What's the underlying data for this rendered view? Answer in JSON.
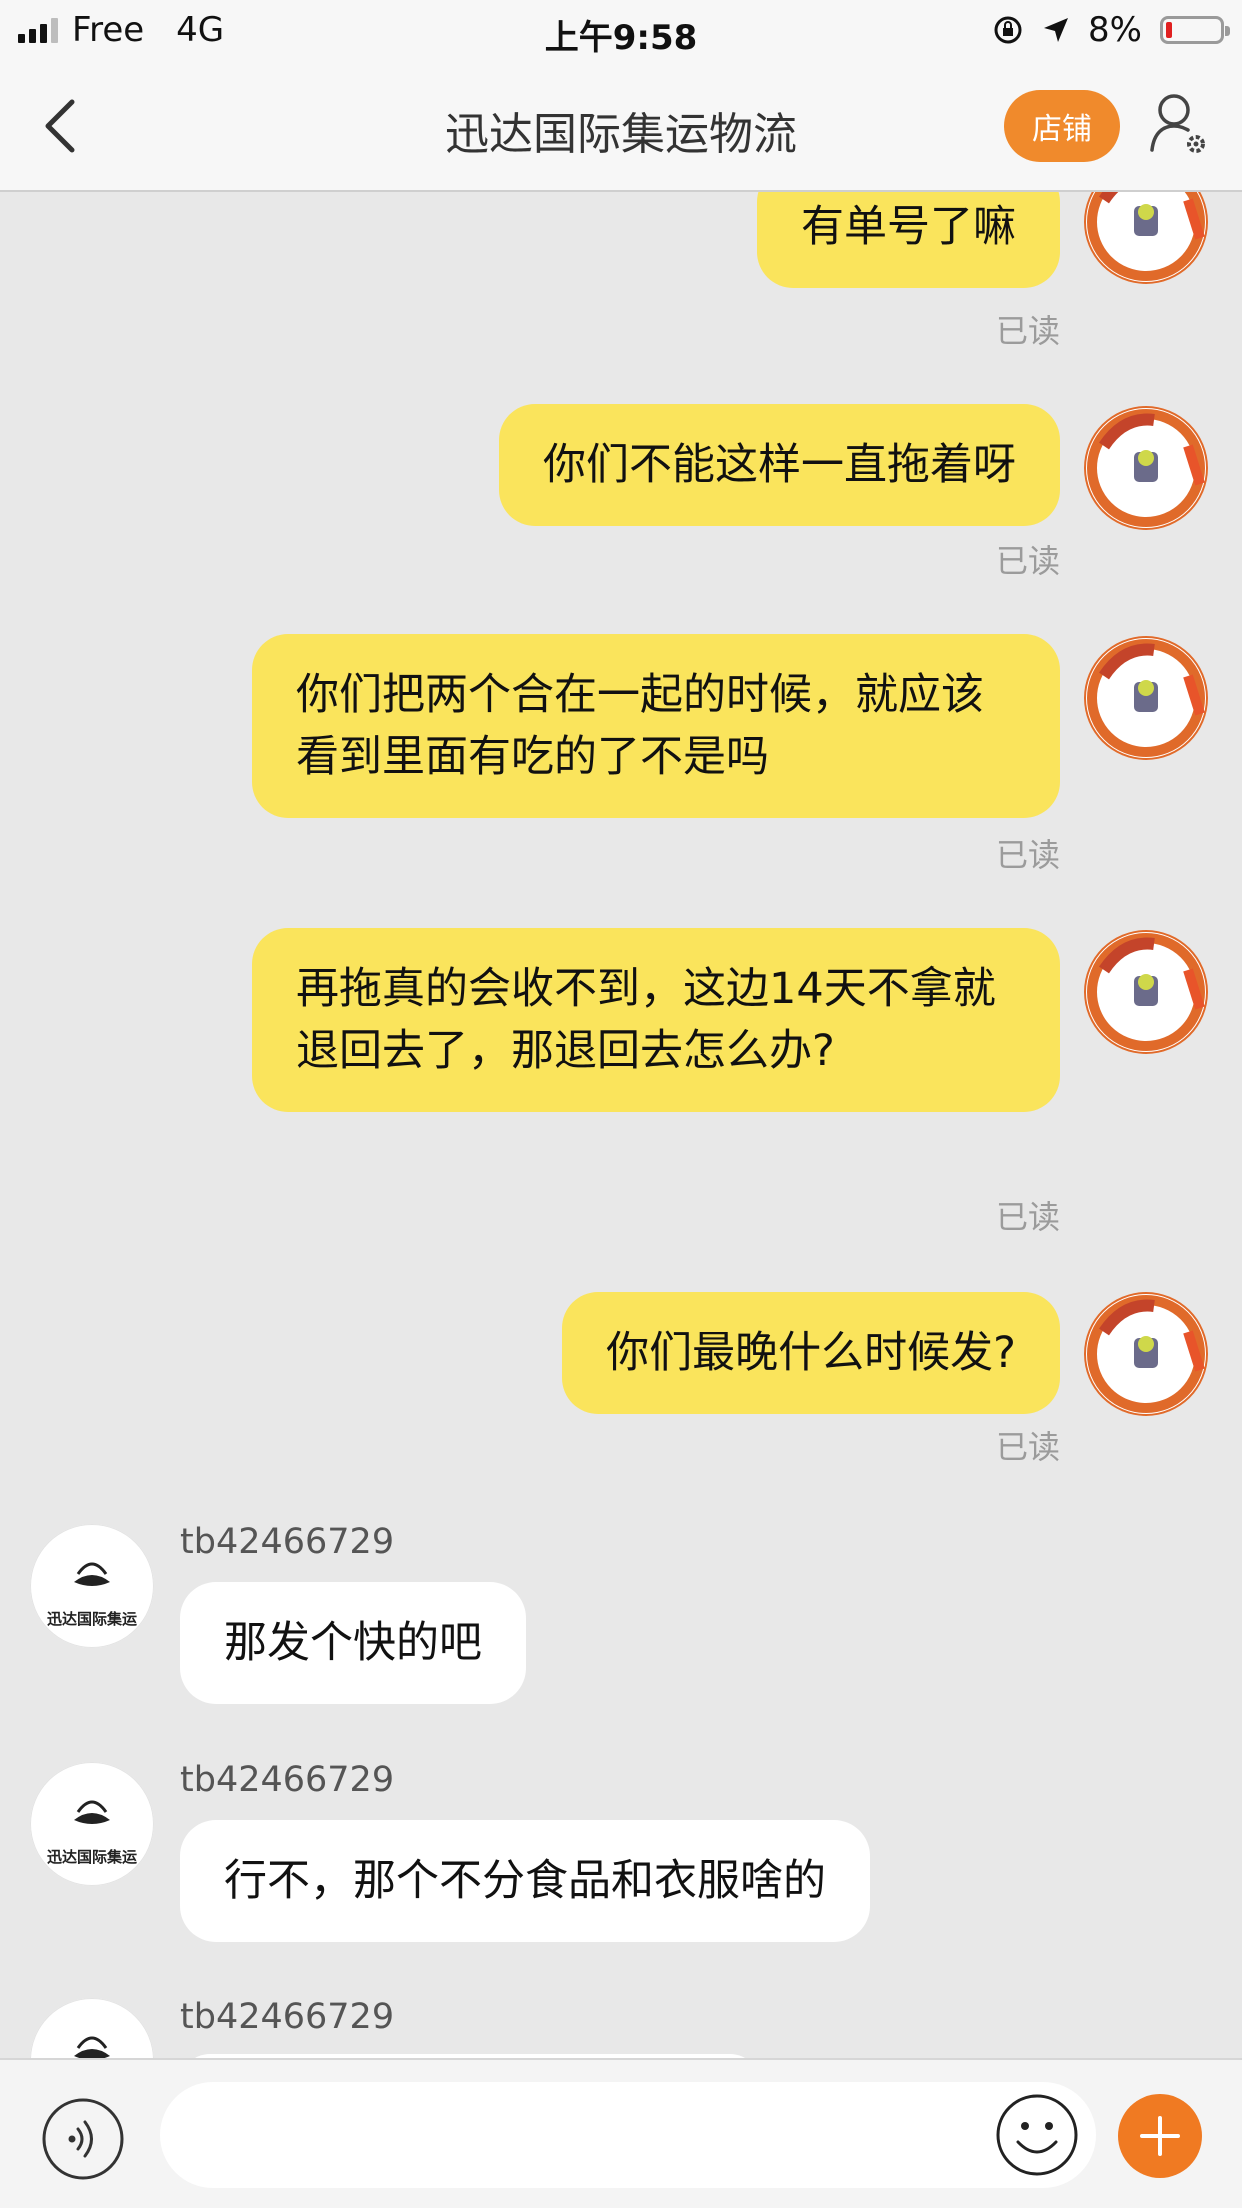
{
  "status_bar": {
    "carrier": "Free",
    "network": "4G",
    "time": "上午9:58",
    "battery": "8%",
    "battery_level": 0.08
  },
  "nav": {
    "title": "迅达国际集运物流",
    "shop_label": "店铺"
  },
  "messages": [
    {
      "from": "me",
      "text": "有单号了嘛",
      "status": "已读"
    },
    {
      "from": "me",
      "text": "你们不能这样一直拖着呀",
      "status": "已读"
    },
    {
      "from": "me",
      "text": "你们把两个合在一起的时候，就应该看到里面有吃的了不是吗",
      "status": "已读"
    },
    {
      "from": "me",
      "text": "再拖真的会收不到，这边14天不拿就退回去了，那退回去怎么办?",
      "status": "已读"
    },
    {
      "from": "me",
      "text": "你们最晚什么时候发?",
      "status": "已读"
    },
    {
      "from": "shop",
      "sender": "tb42466729",
      "text": "那发个快的吧"
    },
    {
      "from": "shop",
      "sender": "tb42466729",
      "text": "行不，那个不分食品和衣服啥的"
    },
    {
      "from": "shop",
      "sender": "tb42466729",
      "text": ""
    }
  ],
  "shop_avatar_text": "迅达国际集运",
  "input": {
    "placeholder": ""
  },
  "icons": {
    "back": "chevron-left-icon",
    "profile": "user-settings-icon",
    "voice": "voice-icon",
    "emoji": "smiley-icon",
    "plus": "plus-icon"
  },
  "colors": {
    "my_bubble": "#fae45c",
    "shop_bubble": "#ffffff",
    "accent": "#f08a2c",
    "battery_low": "#e02020"
  }
}
